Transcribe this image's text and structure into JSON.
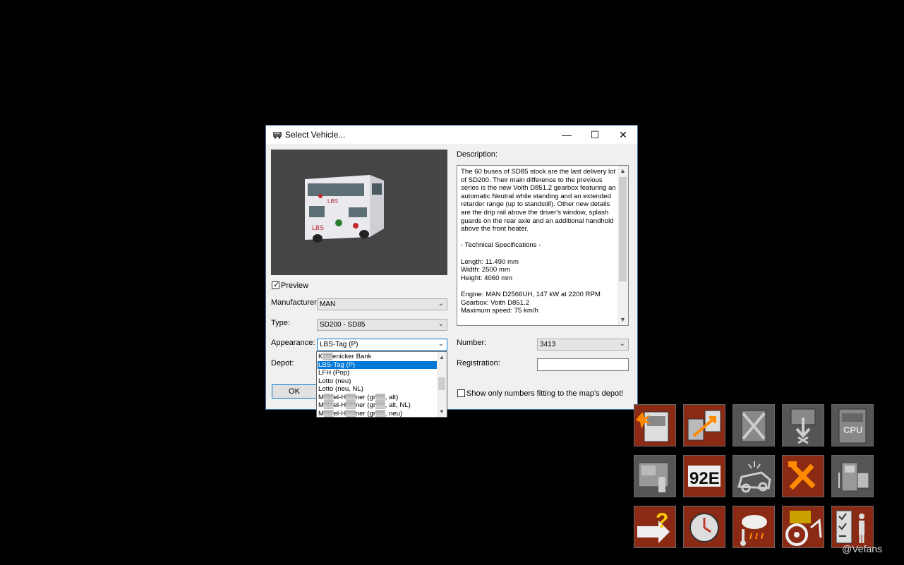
{
  "dialog": {
    "title": "Select Vehicle...",
    "window_buttons": {
      "minimize": "—",
      "maximize": "☐",
      "close": "✕"
    },
    "preview_label": "Preview",
    "preview_checked": true,
    "manufacturer_label": "Manufacturer:",
    "manufacturer_value": "MAN",
    "type_label": "Type:",
    "type_value": "SD200 - SD85",
    "appearance_label": "Appearance:",
    "appearance_value": "LBS-Tag (P)",
    "depot_label": "Depot:",
    "ok_label": "OK",
    "description_label": "Description:",
    "description_text": "The 60 buses of SD85 stock are the last delivery lot of SD200. Their main difference to the previous series is the new Voith D851.2 gearbox featuring an automatic Neutral while standing and an extended retarder range (up to standstill). Other new details are the drip rail above the driver's window, splash guards on the rear axle and an additional handhold above the front heater.\n\n- Technical Specifications -\n\nLength: 11.490 mm\nWidth: 2500 mm\nHeight: 4060 mm\n\nEngine: MAN D2566UH, 147 kW at 2200 RPM\nGearbox: Voith D851.2\nMaximum speed: 75 km/h",
    "number_label": "Number:",
    "number_value": "3413",
    "registration_label": "Registration:",
    "registration_value": "",
    "show_only_label": "Show only numbers fitting to the map's depot!",
    "show_only_checked": false,
    "appearance_options": [
      "K▒▒enicker Bank",
      "LBS-Tag (P)",
      "LFH (Pop)",
      "Lotto (neu)",
      "Lotto (neu, NL)",
      "M▒▒el-H▒▒ner (gr▒▒, alt)",
      "M▒▒el-H▒▒ner (gr▒▒, alt, NL)",
      "M▒▒el-H▒▒ner (gr▒▒, neu)"
    ],
    "appearance_selected_index": 1
  },
  "toolbar_tiles": [
    {
      "name": "bus-fire-icon",
      "color": "red"
    },
    {
      "name": "bus-transfer-icon",
      "color": "red"
    },
    {
      "name": "bus-remove-icon",
      "color": "gray"
    },
    {
      "name": "bus-download-icon",
      "color": "gray"
    },
    {
      "name": "bus-cpu-icon",
      "color": "gray"
    },
    {
      "name": "ticket-printer-icon",
      "color": "gray"
    },
    {
      "name": "route-number-icon",
      "color": "red",
      "text": "92E"
    },
    {
      "name": "car-accident-icon",
      "color": "gray"
    },
    {
      "name": "repair-tools-icon",
      "color": "red"
    },
    {
      "name": "fuel-pump-icon",
      "color": "gray"
    },
    {
      "name": "help-exit-icon",
      "color": "red"
    },
    {
      "name": "timetable-clock-icon",
      "color": "red"
    },
    {
      "name": "weather-icon",
      "color": "red"
    },
    {
      "name": "steering-wheel-icon",
      "color": "red"
    },
    {
      "name": "checklist-elevator-icon",
      "color": "red"
    }
  ],
  "watermark": "@Vefans"
}
